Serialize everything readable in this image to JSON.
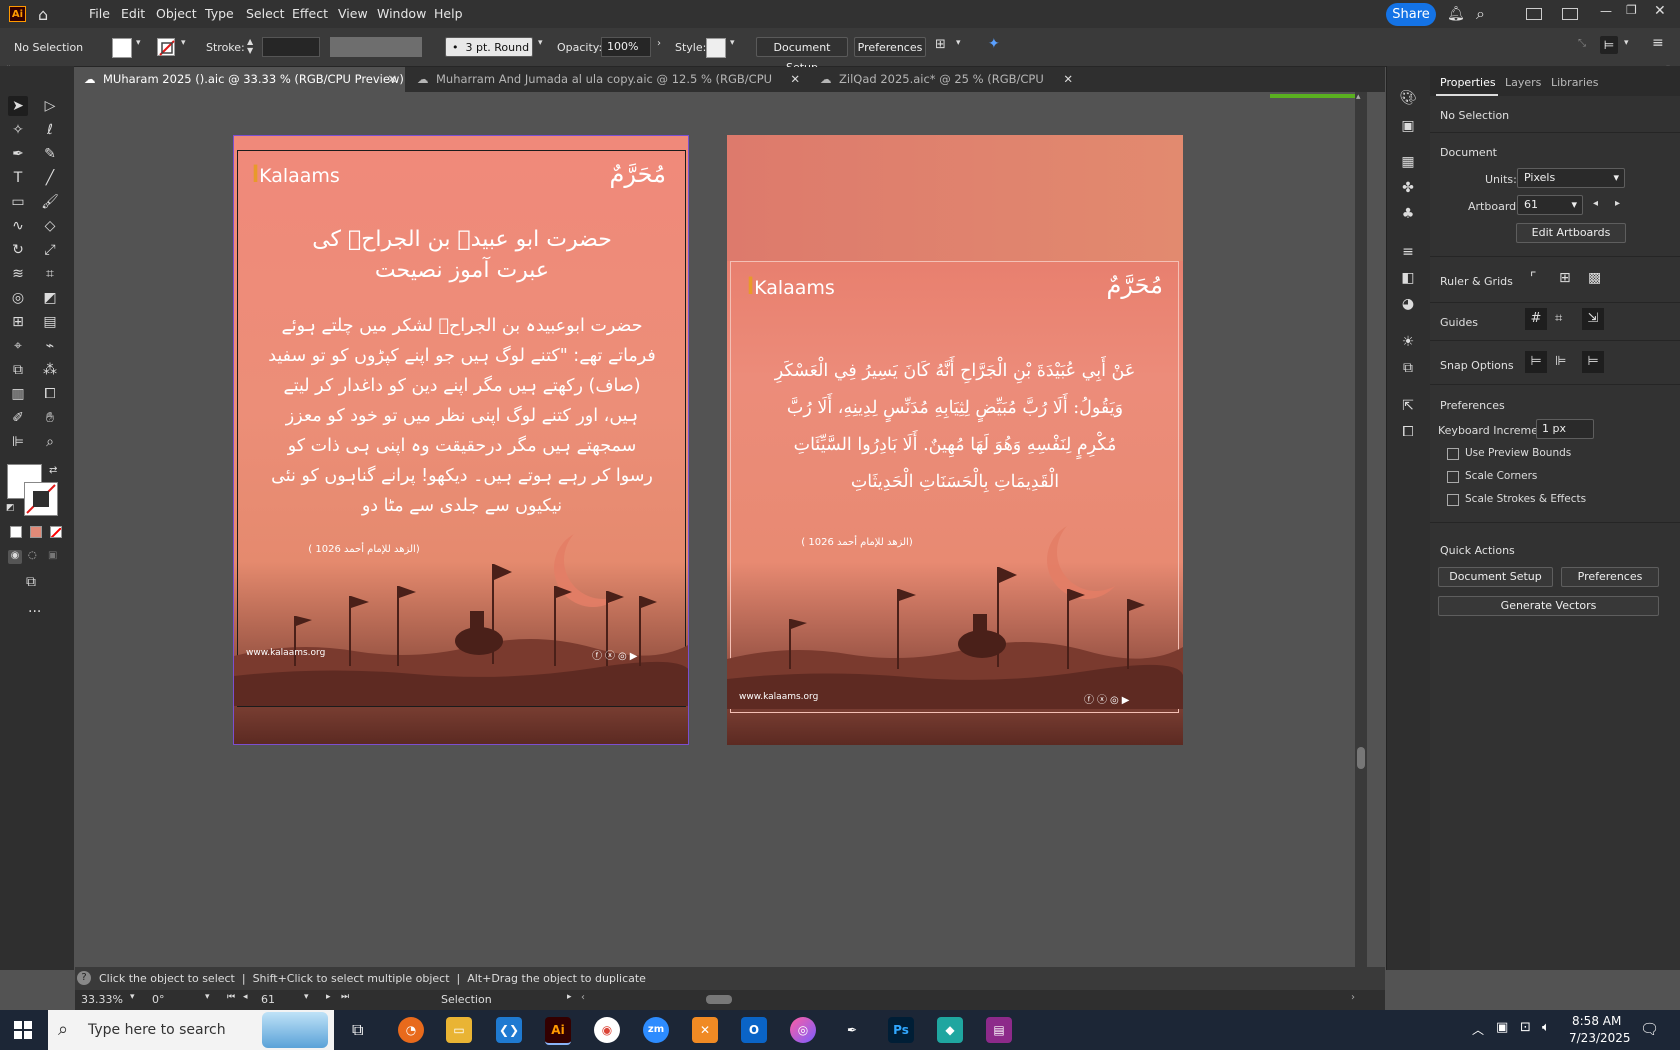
{
  "app": {
    "logo": "Ai",
    "menu": [
      "File",
      "Edit",
      "Object",
      "Type",
      "Select",
      "Effect",
      "View",
      "Window",
      "Help"
    ],
    "share_label": "Share"
  },
  "control_bar": {
    "selection_label": "No Selection",
    "stroke_label": "Stroke:",
    "brush_value": "3 pt. Round",
    "opacity_label": "Opacity:",
    "opacity_value": "100%",
    "style_label": "Style:",
    "document_setup": "Document Setup",
    "preferences": "Preferences"
  },
  "tabs": [
    {
      "label": "MUharam 2025 ().aic @ 33.33 % (RGB/CPU Preview)",
      "active": true
    },
    {
      "label": "Muharram And Jumada al ula copy.aic @ 12.5 % (RGB/CPU Preview)",
      "active": false
    },
    {
      "label": "ZilQad 2025.aic* @ 25 % (RGB/CPU Preview)",
      "active": false
    }
  ],
  "artboard1": {
    "brand": "Kalaams",
    "muharram": "مُحَرَّمٌ",
    "title_line1": "حضرت ابو عبیدہ بن الجراحؓ کی",
    "title_line2": "عبرت آموز نصیحت",
    "body_lines": [
      "حضرت ابوعبیدہ بن الجراحؓ لشکر میں چلتے ہوئے",
      "فرماتے تھے: \"کتنے لوگ ہیں جو اپنے کپڑوں کو تو سفید",
      "(صاف) رکھتے ہیں مگر اپنے دین کو داغدار کر لیتے",
      "ہیں، اور کتنے لوگ اپنی نظر میں تو خود کو معزز",
      "سمجھتے ہیں مگر درحقیقت وہ اپنی ہی ذات کو",
      "رسوا کر رہے ہوتے ہیں۔ دیکھو! پرانے گناہوں کو نئی",
      "نیکیوں سے جلدی سے مٹا دو"
    ],
    "reference": "(الزهد للإمام أحمد 1026 )",
    "website": "www.kalaams.org"
  },
  "artboard2": {
    "brand": "Kalaams",
    "muharram": "مُحَرَّمٌ",
    "arabic_lines": [
      "عَنْ أَبِي عُبَيْدَةَ بْنِ الْجَرَّاحِ أَنَّهُ كَانَ يَسِيرُ فِي الْعَسْكَرِ",
      "وَيَقُولُ: أَلَا رُبَّ مُبَيِّضٍ لِثِيَابِهِ مُدَنِّسٍ لِدِينِهِ، أَلَا رُبَّ",
      "مُكْرِمٍ لِنَفْسِهِ وَهُوَ لَهَا مُهِينٌ. أَلَا بَادِرُوا السَّيِّئَاتِ",
      "الْقَدِيمَاتِ بِالْحَسَنَاتِ الْحَدِيثَاتِ"
    ],
    "reference": "(الزهد للإمام أحمد 1026 )",
    "website": "www.kalaams.org"
  },
  "properties": {
    "tabs": [
      "Properties",
      "Layers",
      "Libraries"
    ],
    "selection": "No Selection",
    "document_header": "Document",
    "units_label": "Units:",
    "units_value": "Pixels",
    "artboard_label": "Artboard:",
    "artboard_value": "61",
    "edit_artboards": "Edit Artboards",
    "ruler_grids": "Ruler & Grids",
    "guides": "Guides",
    "snap_options": "Snap Options",
    "preferences_header": "Preferences",
    "keyboard_increment_label": "Keyboard Increment:",
    "keyboard_increment_value": "1 px",
    "use_preview_bounds": "Use Preview Bounds",
    "scale_corners": "Scale Corners",
    "scale_strokes": "Scale Strokes & Effects",
    "quick_actions": "Quick Actions",
    "document_setup": "Document Setup",
    "preferences": "Preferences",
    "generate_vectors": "Generate Vectors"
  },
  "status": {
    "hint": "Click the object to select  |  Shift+Click to select multiple object  |  Alt+Drag the object to duplicate",
    "zoom": "33.33%",
    "rotation": "0°",
    "artboard": "61",
    "tool": "Selection"
  },
  "taskbar": {
    "search_placeholder": "Type here to search",
    "time": "8:58 AM",
    "date": "7/23/2025"
  },
  "colors": {
    "accent": "#1473e6",
    "artboard_top": "#f08a78",
    "artboard_bottom": "#5c2a22"
  }
}
